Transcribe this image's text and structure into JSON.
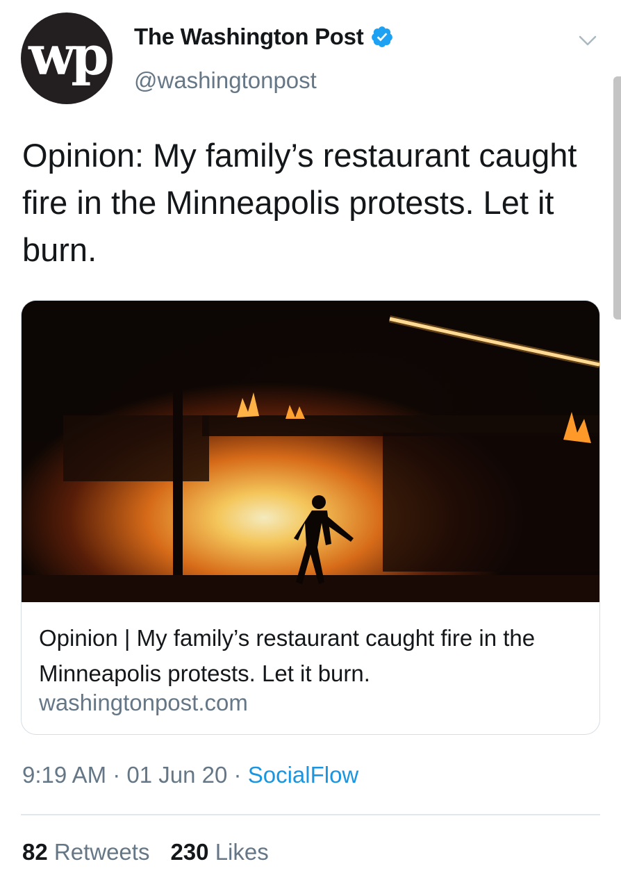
{
  "header": {
    "avatar_text": "wp",
    "display_name": "The Washington Post",
    "handle": "@washingtonpost",
    "verified": true
  },
  "tweet": {
    "text": "Opinion: My family’s restaurant caught fire in the Minneapolis protests. Let it burn."
  },
  "card": {
    "image_alt": "Silhouette of a person walking past a building on fire at night",
    "title": "Opinion | My family’s restaurant caught fire in the Minneapolis protests. Let it burn.",
    "domain": "washingtonpost.com"
  },
  "meta": {
    "time": "9:19 AM",
    "sep1": " · ",
    "date": "01 Jun 20",
    "sep2": " · ",
    "source": "SocialFlow"
  },
  "stats": {
    "retweets_count": "82",
    "retweets_label": "Retweets",
    "likes_count": "230",
    "likes_label": "Likes"
  },
  "colors": {
    "text_primary": "#14171a",
    "text_secondary": "#657786",
    "link": "#1b95e0",
    "verified_badge": "#1da1f2",
    "avatar_bg": "#231f20",
    "border": "#d6dde3"
  },
  "icons": {
    "verified": "verified-badge-icon",
    "more": "chevron-down-icon"
  }
}
